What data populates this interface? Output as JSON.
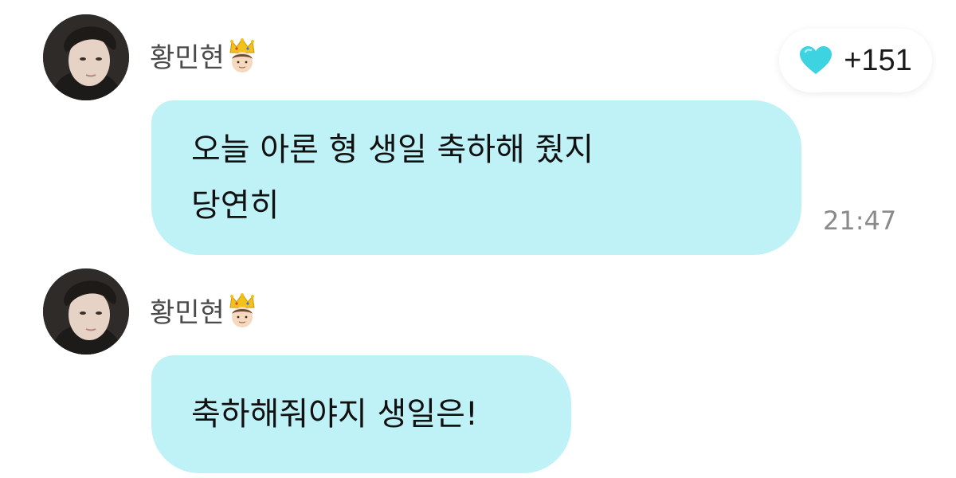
{
  "like_button": {
    "icon": "heart-icon",
    "count": "+151",
    "color": "#3ed3e0"
  },
  "messages": [
    {
      "sender": "황민현",
      "badge_icon": "crown-face-icon",
      "lines": [
        "오늘 아론 형 생일 축하해 줬지",
        "당연히"
      ],
      "time": "21:47"
    },
    {
      "sender": "황민현",
      "badge_icon": "crown-face-icon",
      "lines": [
        "축하해줘야지 생일은!"
      ]
    }
  ],
  "colors": {
    "bubble": "#bff2f6",
    "name": "#4a4a4a",
    "time": "#8a8a8a"
  }
}
